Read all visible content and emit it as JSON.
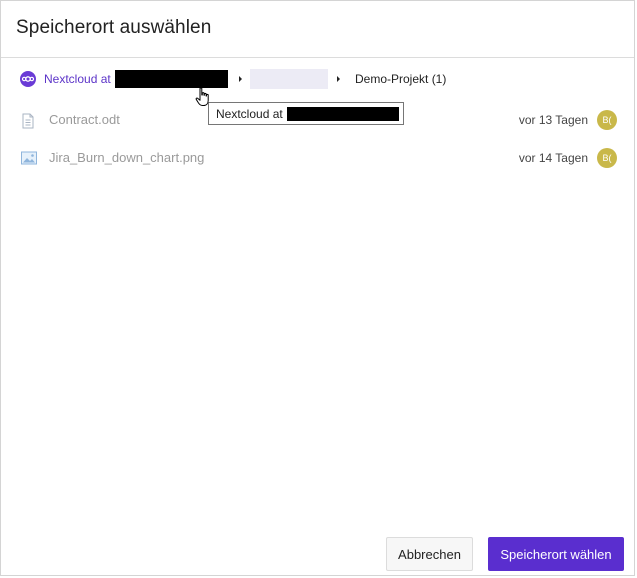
{
  "dialog": {
    "title": "Speicherort auswählen"
  },
  "breadcrumb": {
    "root_label": "Nextcloud at",
    "current_label": "Demo-Projekt (1)"
  },
  "tooltip": {
    "text": "Nextcloud at"
  },
  "files": [
    {
      "name": "Contract.odt",
      "date": "vor 13 Tagen",
      "avatar": "B(",
      "icon": "document-icon"
    },
    {
      "name": "Jira_Burn_down_chart.png",
      "date": "vor 14 Tagen",
      "avatar": "B(",
      "icon": "image-icon"
    }
  ],
  "buttons": {
    "cancel_label": "Abbrechen",
    "confirm_label": "Speicherort wählen"
  },
  "colors": {
    "accent": "#5a2ecf",
    "avatar": "#c9b84a",
    "redaction": "#000000"
  }
}
